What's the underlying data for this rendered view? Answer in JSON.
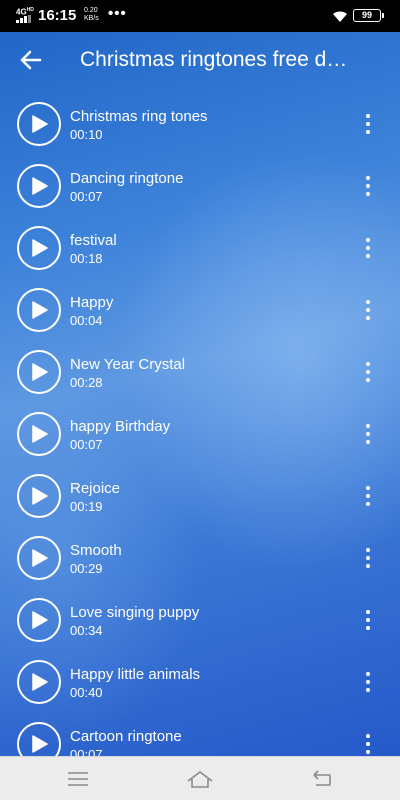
{
  "status_bar": {
    "network": "4G",
    "network_sup": "HD",
    "time": "16:15",
    "speed_value": "0.20",
    "speed_unit": "KB/s",
    "more": "•••",
    "battery": "99"
  },
  "header": {
    "back_icon": "arrow-left-icon",
    "title": "Christmas ringtones free d…"
  },
  "ringtones": [
    {
      "title": "Christmas ring tones",
      "duration": "00:10"
    },
    {
      "title": "Dancing ringtone",
      "duration": "00:07"
    },
    {
      "title": "festival",
      "duration": "00:18"
    },
    {
      "title": "Happy",
      "duration": "00:04"
    },
    {
      "title": "New Year Crystal",
      "duration": "00:28"
    },
    {
      "title": "happy Birthday",
      "duration": "00:07"
    },
    {
      "title": "Rejoice",
      "duration": "00:19"
    },
    {
      "title": "Smooth",
      "duration": "00:29"
    },
    {
      "title": "Love singing puppy",
      "duration": "00:34"
    },
    {
      "title": "Happy little animals",
      "duration": "00:40"
    },
    {
      "title": "Cartoon ringtone",
      "duration": "00:07"
    }
  ],
  "nav_bar": {
    "icons": [
      "menu-icon",
      "home-icon",
      "back-icon"
    ]
  },
  "colors": {
    "accent": "#3d82da",
    "text": "#ffffff",
    "nav_bg": "#ececec"
  }
}
